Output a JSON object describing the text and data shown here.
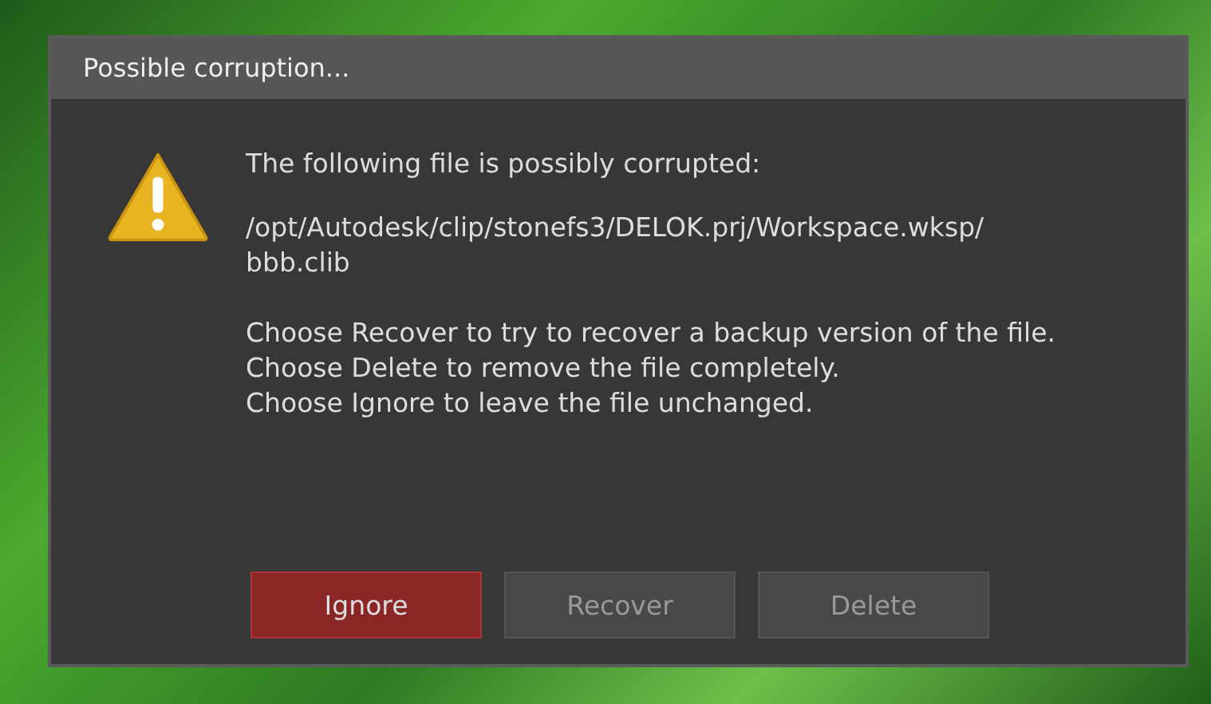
{
  "dialog": {
    "title": "Possible corruption...",
    "message": "The following file is possibly corrupted:",
    "path": [
      "/opt/Autodesk/clip/stonefs3/DELOK.prj/Workspace.wksp/",
      "bbb.clib"
    ],
    "instructions": [
      "Choose Recover to try to recover a backup version of the file.",
      "Choose Delete to remove the file completely.",
      "Choose Ignore to leave the file unchanged."
    ],
    "buttons": [
      {
        "label": "Ignore",
        "selected": true
      },
      {
        "label": "Recover",
        "selected": false
      },
      {
        "label": "Delete",
        "selected": false
      }
    ]
  }
}
